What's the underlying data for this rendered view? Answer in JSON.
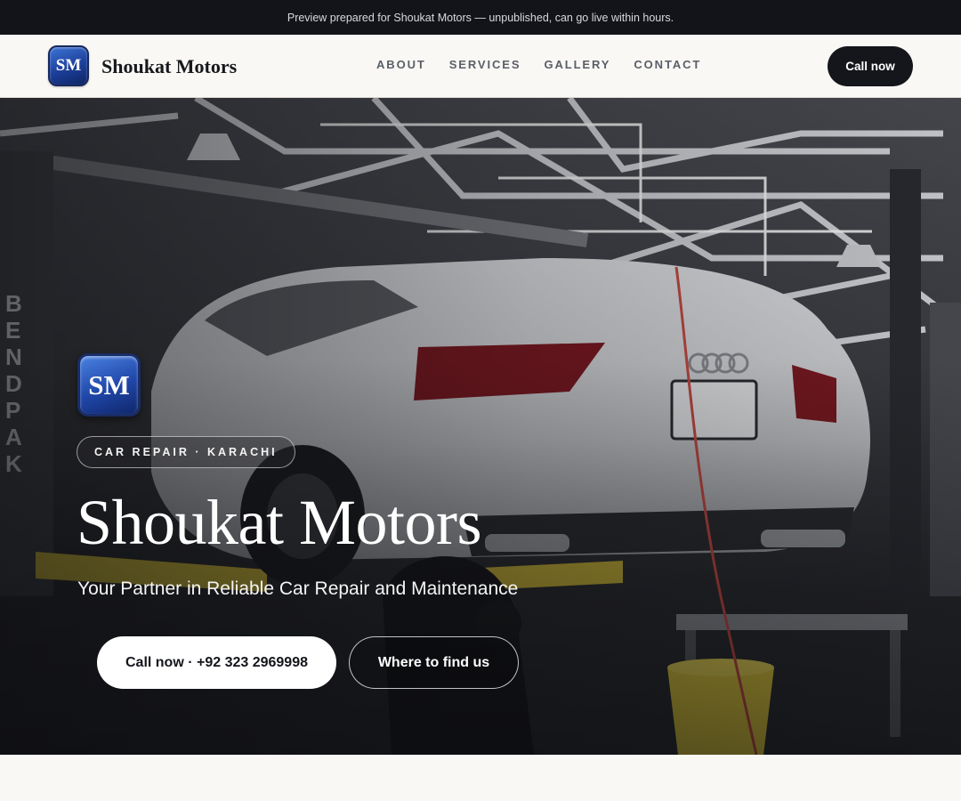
{
  "preview_bar": {
    "text": "Preview prepared for Shoukat Motors — unpublished, can go live within hours."
  },
  "nav": {
    "logo_text": "SM",
    "brand_name": "Shoukat Motors",
    "links": [
      "ABOUT",
      "SERVICES",
      "GALLERY",
      "CONTACT"
    ],
    "cta_label": "Call now"
  },
  "hero": {
    "logo_text": "SM",
    "tag": "CAR REPAIR · KARACHI",
    "title": "Shoukat Motors",
    "subtitle": "Your Partner in Reliable Car Repair and Maintenance",
    "primary_button": "Call now · +92 323 2969998",
    "secondary_button": "Where to find us",
    "image_description_icon": "garage-photo"
  },
  "colors": {
    "dark": "#14161b",
    "page_bg": "#faf8f4",
    "logo_blue": "#1f46a8"
  }
}
